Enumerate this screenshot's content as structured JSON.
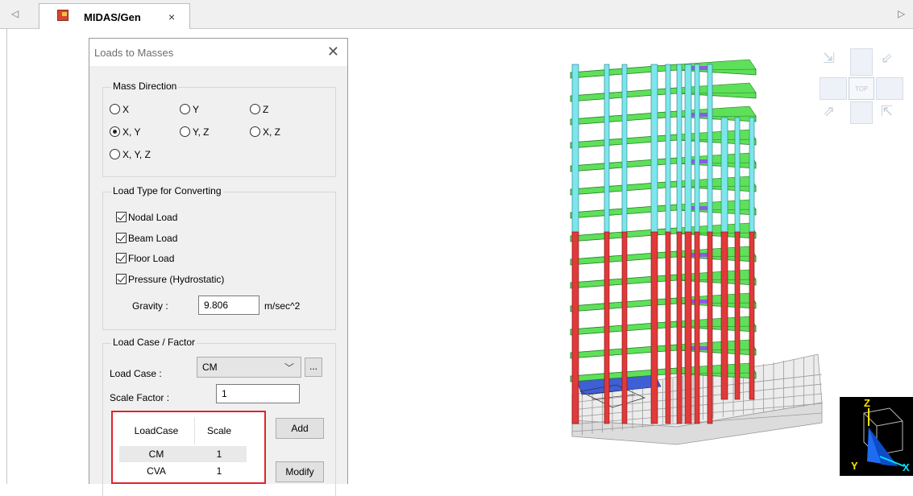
{
  "tab": {
    "title": "MIDAS/Gen",
    "close": "×",
    "scroll_left": "◁",
    "scroll_right": "▷"
  },
  "dialog": {
    "title": "Loads to Masses",
    "close": "✕",
    "mass_direction": {
      "title": "Mass Direction",
      "options": [
        "X",
        "Y",
        "Z",
        "X, Y",
        "Y, Z",
        "X, Z",
        "X, Y, Z"
      ],
      "selected": "X, Y"
    },
    "load_type": {
      "title": "Load Type for Converting",
      "items": [
        {
          "label": "Nodal Load",
          "checked": true
        },
        {
          "label": "Beam Load",
          "checked": true
        },
        {
          "label": "Floor Load",
          "checked": true
        },
        {
          "label": "Pressure (Hydrostatic)",
          "checked": true
        }
      ],
      "gravity_label": "Gravity :",
      "gravity_value": "9.806",
      "gravity_unit": "m/sec^2"
    },
    "load_case": {
      "title": "Load Case / Factor",
      "load_case_label": "Load Case :",
      "load_case_value": "CM",
      "browse_label": "...",
      "scale_factor_label": "Scale Factor :",
      "scale_factor_value": "1",
      "add_label": "Add",
      "modify_label": "Modify",
      "table": {
        "columns": [
          "LoadCase",
          "Scale"
        ],
        "rows": [
          [
            "CM",
            "1"
          ],
          [
            "CVA",
            "1"
          ]
        ]
      }
    }
  },
  "view": {
    "nav_cube_label": "TOP",
    "axis_labels": {
      "z": "Z",
      "x": "X",
      "y": "Y"
    }
  },
  "colors": {
    "highlight_border": "#e0232e",
    "beam_green": "#5fe05a",
    "column_cyan": "#7de6ea",
    "column_red": "#e03a3a",
    "brace_purple": "#8c5ce6"
  }
}
